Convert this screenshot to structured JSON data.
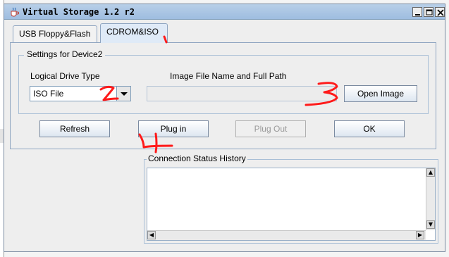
{
  "window": {
    "title": "Virtual Storage 1.2 r2",
    "title_icon": "java-cup-icon",
    "controls": [
      "minimize-icon",
      "maximize-icon",
      "close-icon"
    ]
  },
  "tabs": [
    {
      "label": "USB Floppy&Flash",
      "selected": false
    },
    {
      "label": "CDROM&ISO",
      "selected": true
    }
  ],
  "settings": {
    "group_title": "Settings for Device2",
    "drive_type_label": "Logical Drive Type",
    "drive_type_value": "ISO File",
    "path_label": "Image File Name and Full Path",
    "path_value": "",
    "open_image_label": "Open Image"
  },
  "actions": {
    "refresh": "Refresh",
    "plug_in": "Plug in",
    "plug_out": "Plug Out",
    "plug_out_enabled": false,
    "ok": "OK"
  },
  "history": {
    "title": "Connection Status History",
    "entries": []
  },
  "annotations": [
    "1",
    "2",
    "3",
    "4"
  ],
  "colors": {
    "annotation_red": "#ff1a1a",
    "title_gradient": "#9ebde0",
    "selected_tab": "#dfeaf7"
  }
}
